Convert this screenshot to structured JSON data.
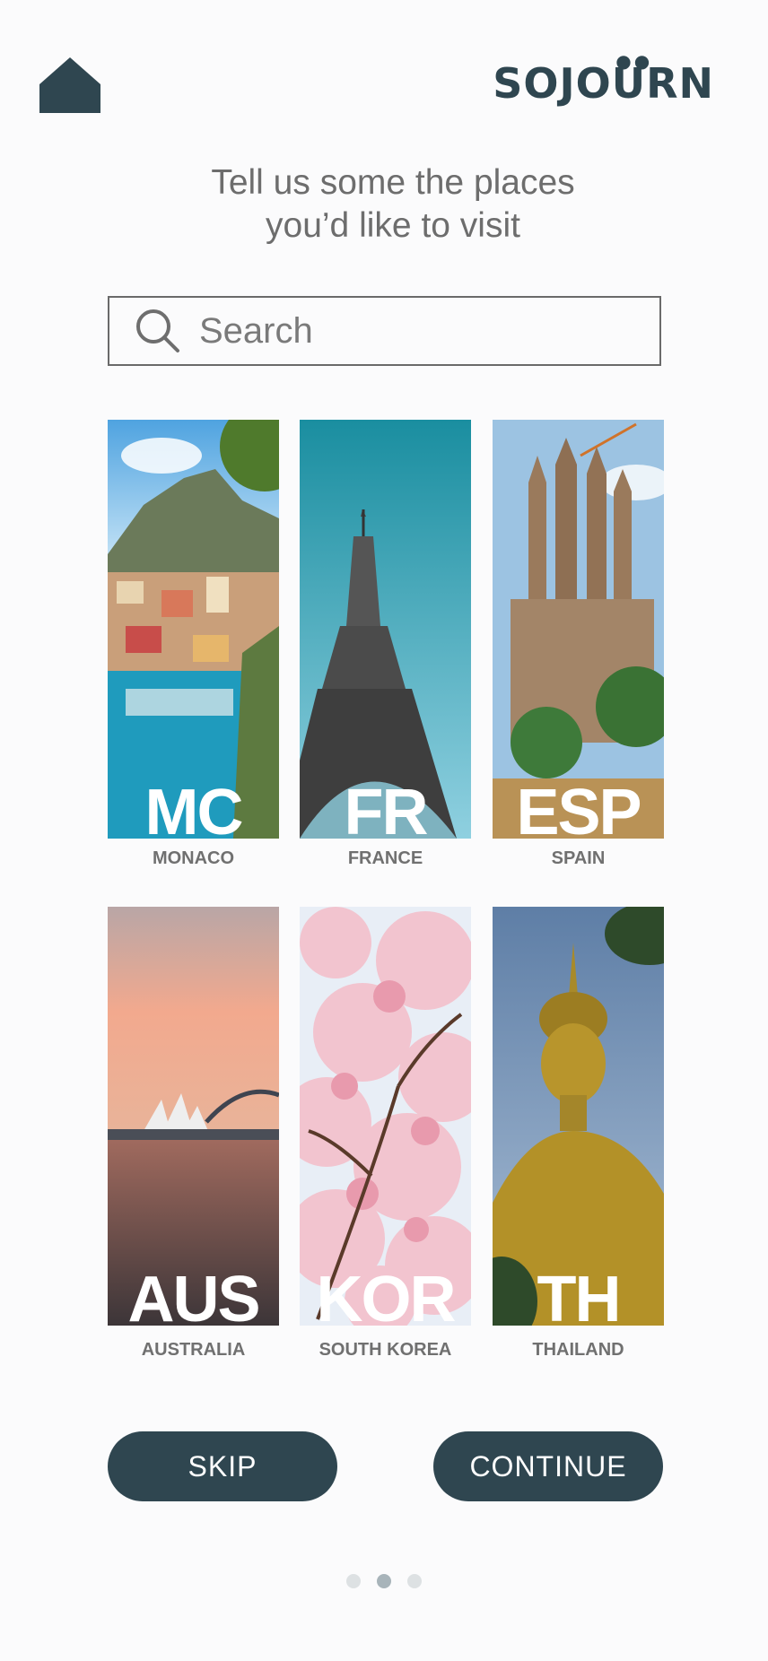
{
  "brand": "SOJOURN",
  "headline": [
    "Tell us some the places",
    "you’d like to visit"
  ],
  "search": {
    "placeholder": "Search"
  },
  "destinations": [
    {
      "code": "MC",
      "name": "MONACO"
    },
    {
      "code": "FR",
      "name": "FRANCE"
    },
    {
      "code": "ESP",
      "name": "SPAIN"
    },
    {
      "code": "AUS",
      "name": "AUSTRALIA"
    },
    {
      "code": "KOR",
      "name": "SOUTH KOREA"
    },
    {
      "code": "TH",
      "name": "THAILAND"
    }
  ],
  "buttons": {
    "skip": "SKIP",
    "continue": "CONTINUE"
  },
  "pagination": {
    "total": 3,
    "current": 2
  },
  "colors": {
    "primary": "#2f4650",
    "text_muted": "#707070"
  },
  "icons": {
    "home": "home-icon",
    "search": "search-icon"
  }
}
